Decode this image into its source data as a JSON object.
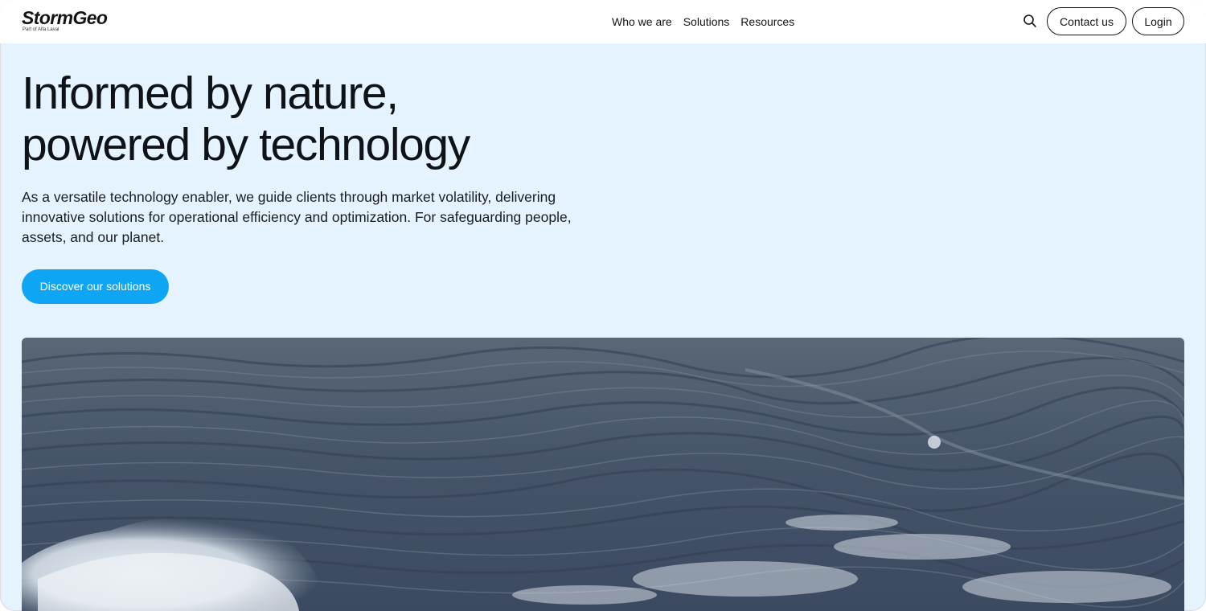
{
  "brand": {
    "name": "StormGeo",
    "tagline": "Part of Alfa Laval"
  },
  "nav": {
    "items": [
      {
        "label": "Who we are"
      },
      {
        "label": "Solutions"
      },
      {
        "label": "Resources"
      }
    ]
  },
  "header": {
    "search_icon": "search-icon",
    "contact_label": "Contact us",
    "login_label": "Login"
  },
  "hero": {
    "title_line1": "Informed by nature,",
    "title_line2": "powered by technology",
    "description": "As a versatile technology enabler, we guide clients through market volatility, delivering innovative solutions for operational efficiency and optimization. For safeguarding people, assets, and our planet.",
    "cta_label": "Discover our solutions"
  },
  "colors": {
    "hero_background": "#e4f3fd",
    "accent": "#0ea5f5",
    "text": "#0f1216",
    "sea": "#4a586c"
  }
}
